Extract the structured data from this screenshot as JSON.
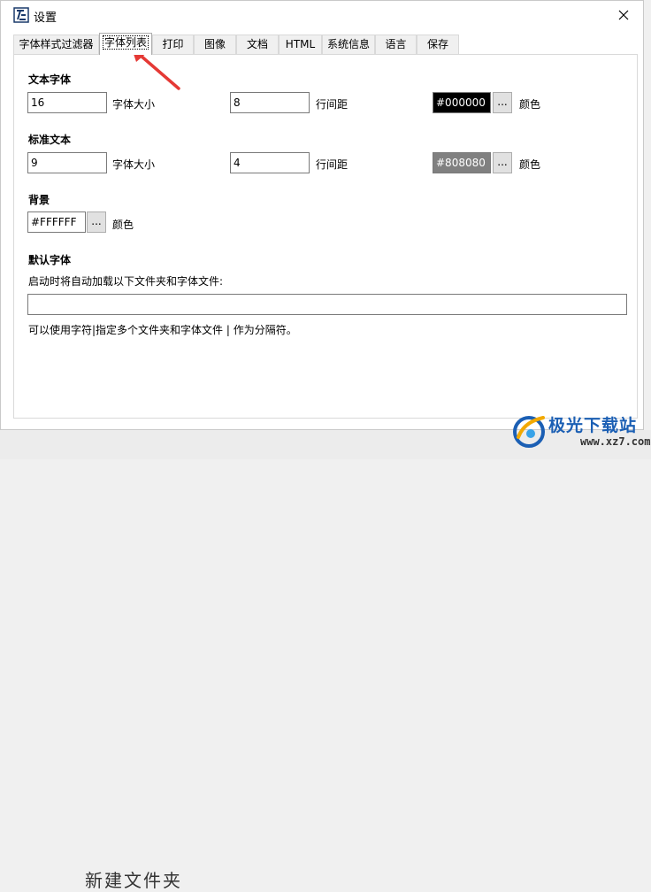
{
  "window": {
    "title": "设置"
  },
  "tabs": [
    {
      "label": "字体样式过滤器",
      "active": false
    },
    {
      "label": "字体列表",
      "active": true
    },
    {
      "label": "打印",
      "active": false
    },
    {
      "label": "图像",
      "active": false
    },
    {
      "label": "文档",
      "active": false
    },
    {
      "label": "HTML",
      "active": false
    },
    {
      "label": "系统信息",
      "active": false
    },
    {
      "label": "语言",
      "active": false
    },
    {
      "label": "保存",
      "active": false
    }
  ],
  "text_font": {
    "heading": "文本字体",
    "size_value": "16",
    "size_label": "字体大小",
    "spacing_value": "8",
    "spacing_label": "行间距",
    "color_value": "#000000",
    "color_label": "颜色",
    "browse_label": "..."
  },
  "standard_text": {
    "heading": "标准文本",
    "size_value": "9",
    "size_label": "字体大小",
    "spacing_value": "4",
    "spacing_label": "行间距",
    "color_value": "#808080",
    "color_label": "颜色",
    "browse_label": "..."
  },
  "background": {
    "heading": "背景",
    "color_value": "#FFFFFF",
    "color_label": "颜色",
    "browse_label": "..."
  },
  "default_font": {
    "heading": "默认字体",
    "description": "启动时将自动加载以下文件夹和字体文件:",
    "path_value": "",
    "hint": "可以使用字符|指定多个文件夹和字体文件 | 作为分隔符。"
  },
  "background_window": {
    "text": "新建文件夹"
  },
  "watermark": {
    "brand": "极光下载站",
    "url": "www.xz7.com"
  },
  "colors": {
    "accent": "#1b5fb4",
    "arrow": "#e53935"
  }
}
